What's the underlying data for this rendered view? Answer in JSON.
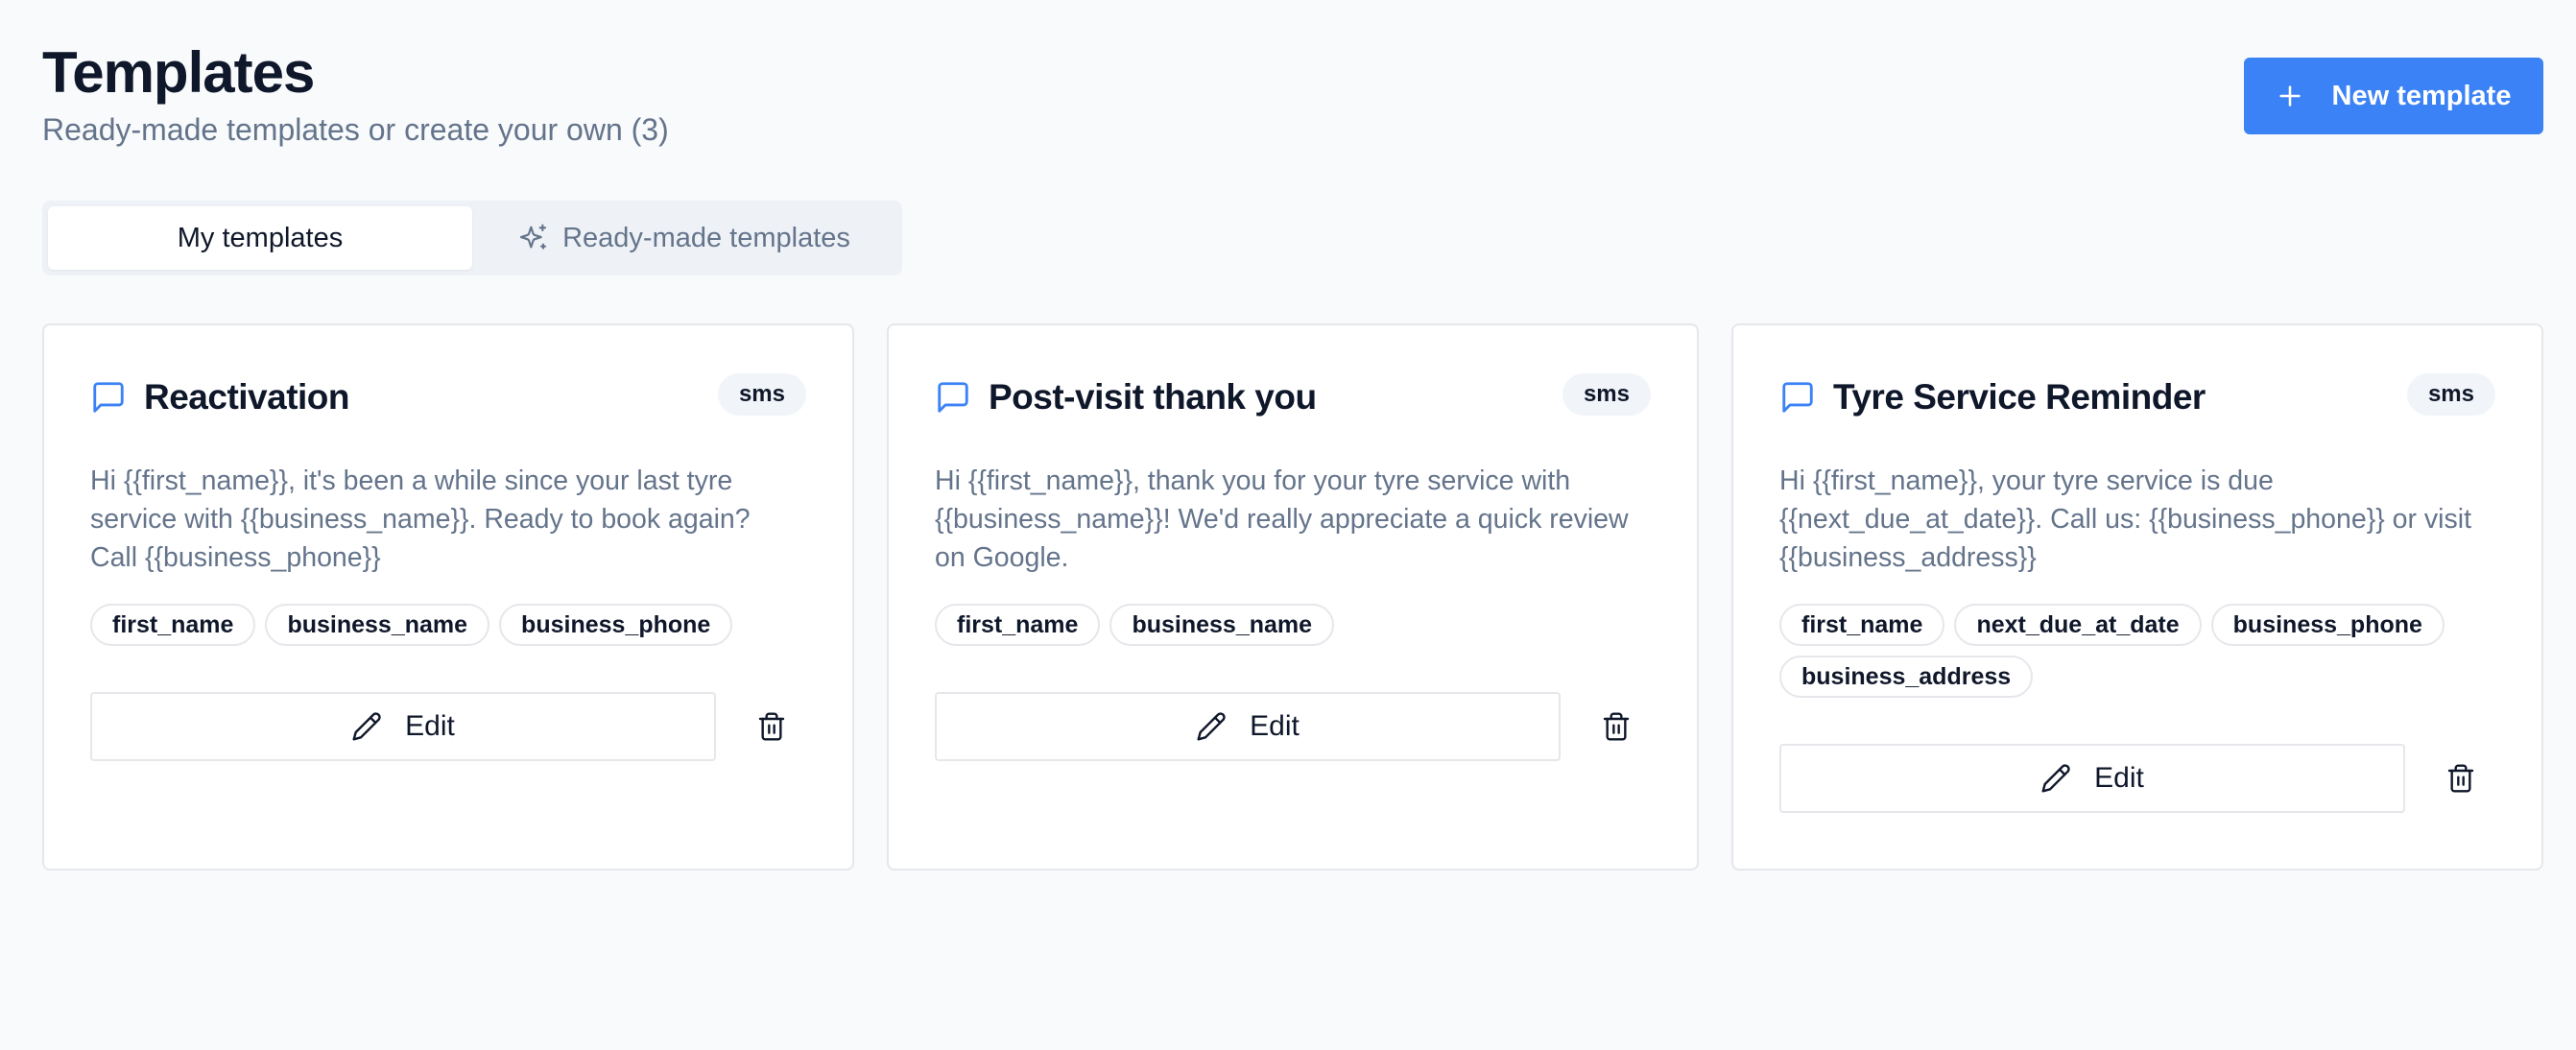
{
  "header": {
    "title": "Templates",
    "subtitle": "Ready-made templates or create your own (3)",
    "new_button_label": "New template"
  },
  "tabs": [
    {
      "label": "My templates",
      "active": true
    },
    {
      "label": "Ready-made templates",
      "active": false,
      "icon": "sparkles-icon"
    }
  ],
  "cards": [
    {
      "title": "Reactivation",
      "channel": "sms",
      "body": "Hi {{first_name}}, it's been a while since your last tyre\nservice with {{business_name}}. Ready to book again?\nCall {{business_phone}}",
      "variables": [
        "first_name",
        "business_name",
        "business_phone"
      ],
      "edit_label": "Edit"
    },
    {
      "title": "Post-visit thank you",
      "channel": "sms",
      "body": "Hi {{first_name}}, thank you for your tyre service with\n{{business_name}}! We'd really appreciate a quick review\non Google.",
      "variables": [
        "first_name",
        "business_name"
      ],
      "edit_label": "Edit"
    },
    {
      "title": "Tyre Service Reminder",
      "channel": "sms",
      "body": "Hi {{first_name}}, your tyre service is due\n{{next_due_at_date}}. Call us: {{business_phone}} or visit\n{{business_address}}",
      "variables": [
        "first_name",
        "next_due_at_date",
        "business_phone",
        "business_address"
      ],
      "edit_label": "Edit"
    }
  ],
  "colors": {
    "accent": "#3b82f6",
    "background": "#f8fafc",
    "muted_text": "#64748b",
    "border": "#e5e7eb"
  }
}
